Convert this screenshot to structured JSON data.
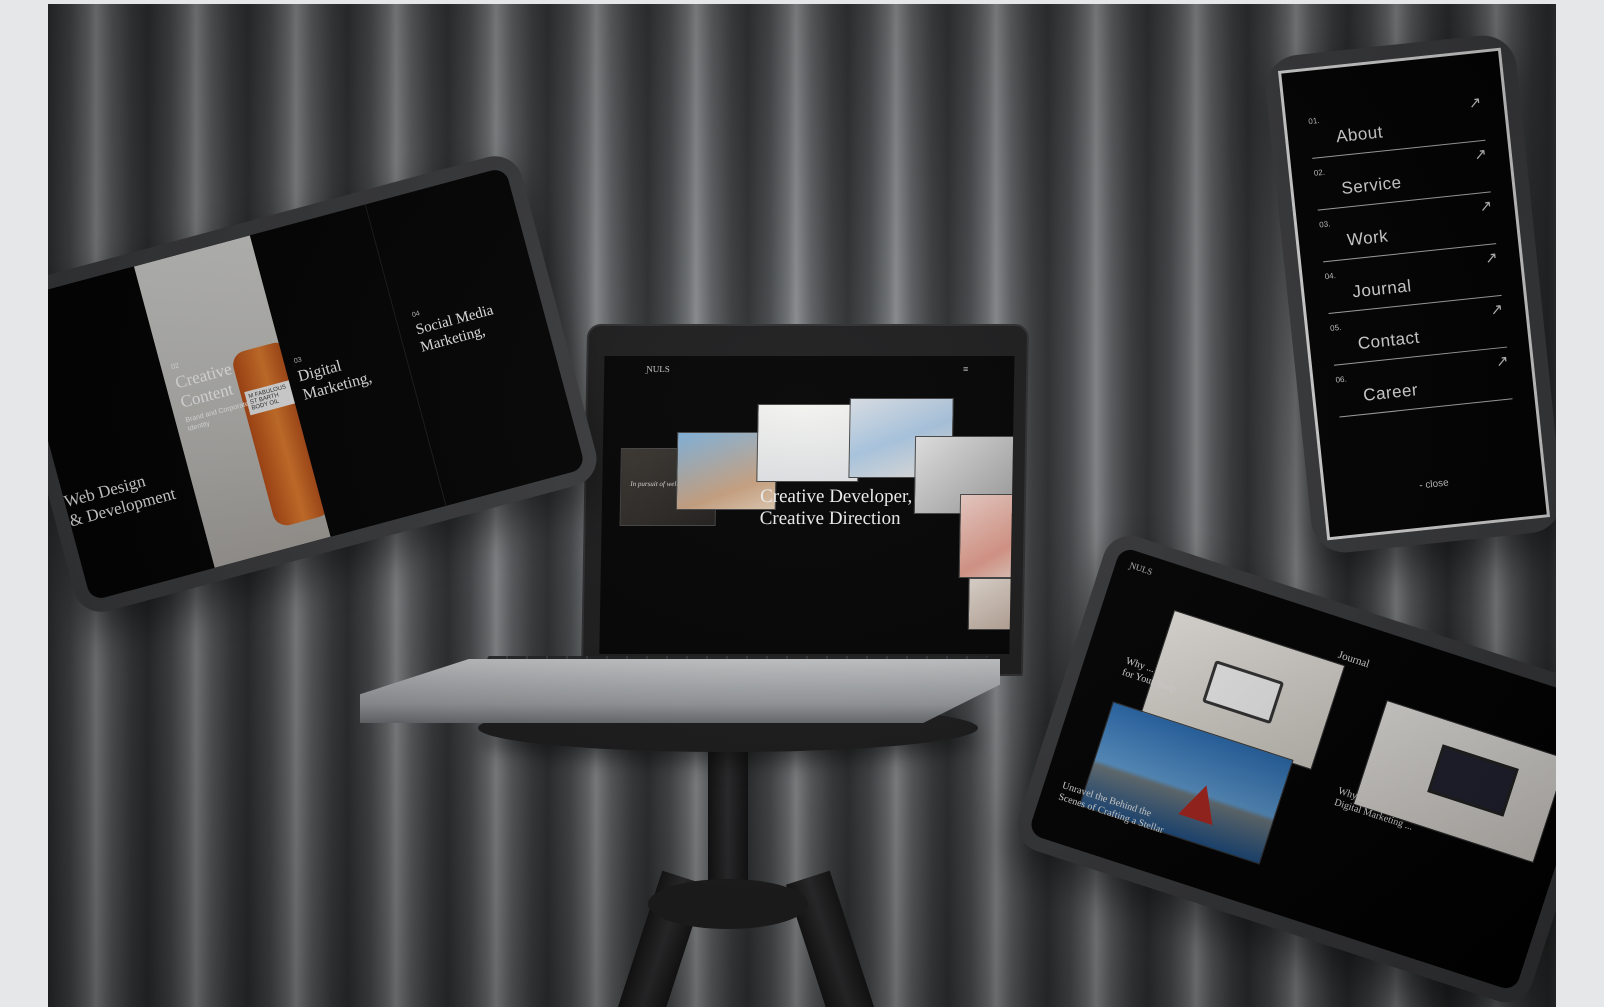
{
  "tablet_left": {
    "panels": [
      {
        "num": "",
        "title": "Web Design\n& Development",
        "sub": ""
      },
      {
        "num": "02",
        "title": "Creative\nContent",
        "sub": "Brand and Corporate\nIdentity"
      },
      {
        "num": "03",
        "title": "Digital\nMarketing,",
        "sub": ""
      },
      {
        "num": "04",
        "title": "Social Media\nMarketing,",
        "sub": ""
      }
    ],
    "product_label": "M FABULOUS\nST BARTH BODY OIL"
  },
  "laptop": {
    "logo": "ƝULS",
    "menu_icon": "menu-icon",
    "headline": "Creative Developer,\nCreative Direction",
    "caption": "In pursuit of wellness"
  },
  "phone_menu": {
    "items": [
      {
        "num": "01.",
        "label": "About"
      },
      {
        "num": "02.",
        "label": "Service"
      },
      {
        "num": "03.",
        "label": "Work"
      },
      {
        "num": "04.",
        "label": "Journal"
      },
      {
        "num": "05.",
        "label": "Contact"
      },
      {
        "num": "06.",
        "label": "Career"
      }
    ],
    "arrow": "↗",
    "close": "close"
  },
  "tablet_right": {
    "logo": "ƝULS",
    "section_title": "Journal",
    "articles": [
      {
        "title": "Why ... \nfor Your Shop"
      },
      {
        "title": "Why ... \nDigital Marketing ..."
      },
      {
        "title": "Unravel the Behind the\nScenes of Crafting a Stellar"
      }
    ]
  },
  "colors": {
    "screen_bg": "#000000",
    "device_frame": "#3a3b3d",
    "text": "#f2f2f2"
  }
}
